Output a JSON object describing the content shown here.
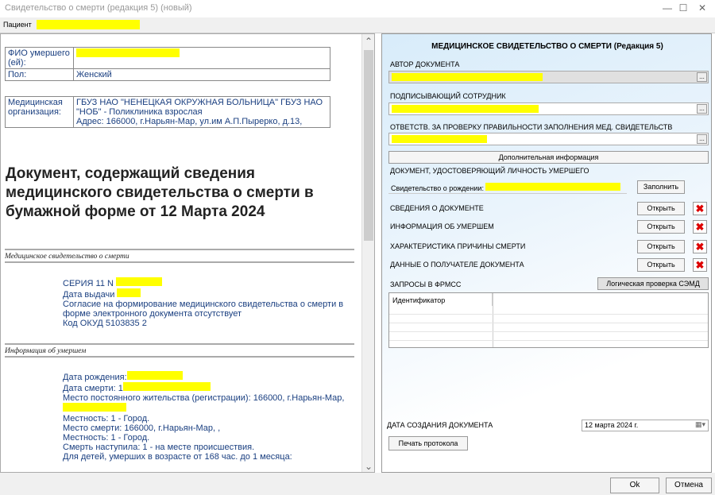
{
  "window": {
    "title": "Свидетельство о смерти (редакция 5) (новый)",
    "minimize": "—",
    "maximize": "☐",
    "close": "✕"
  },
  "patient": {
    "label": "Пациент"
  },
  "left": {
    "info_rows": [
      {
        "key": "ФИО умершего (ей):",
        "value": ""
      },
      {
        "key": "Пол:",
        "value": "Женский"
      }
    ],
    "org": {
      "key": "Медицинская организация:",
      "value": "ГБУЗ НАО \"НЕНЕЦКАЯ ОКРУЖНАЯ БОЛЬНИЦА\" ГБУЗ НАО \"НОБ\" - Поликлиника взрослая",
      "address": "Адрес: 166000, г.Нарьян-Мар, ул.им А.П.Пырерко, д.13,"
    },
    "doc_title": "Документ, содержащий сведения медицинского свидетельства о смерти в бумажной форме от 12 Марта 2024",
    "section1": {
      "title": "Медицинское свидетельство о смерти",
      "series": "СЕРИЯ 11 N",
      "issue_date": "Дата выдачи",
      "consent": "Согласие на формирование медицинского свидетельства о смерти в форме электронного документа отсутствует",
      "okud": "Код ОКУД 5103835 2"
    },
    "section2": {
      "title": "Информация об умершем",
      "birth": "Дата рождения:",
      "death": "Дата смерти: 1",
      "residence": "Место постоянного жительства (регистрации): 166000, г.Нарьян-Мар,",
      "locality1": "Местность: 1 - Город.",
      "death_place": "Место смерти: 166000, г.Нарьян-Мар, ,",
      "locality2": "Местность: 1 - Город.",
      "occurred": "Смерть наступила: 1 - на месте происшествия.",
      "children": "Для детей, умерших в возрасте от 168 час. до 1 месяца:"
    }
  },
  "right": {
    "title": "МЕДИЦИНСКОЕ СВИДЕТЕЛЬСТВО О СМЕРТИ (Редакция 5)",
    "author_label": "АВТОР ДОКУМЕНТА",
    "author_value": "",
    "signer_label": "ПОДПИСЫВАЮЩИЙ СОТРУДНИК",
    "signer_value": "",
    "checker_label": "ОТВЕТСТВ. ЗА ПРОВЕРКУ ПРАВИЛЬНОСТИ ЗАПОЛНЕНИЯ МЕД. СВИДЕТЕЛЬСТВ",
    "checker_value": "",
    "extra_btn": "Дополнительная информация",
    "id_doc_label": "ДОКУМЕНТ, УДОСТОВЕРЯЮЩИЙ ЛИЧНОСТЬ УМЕРШЕГО",
    "id_doc_value": "Свидетельство о рождении:",
    "fill_btn": "Заполнить",
    "sections": [
      {
        "label": "СВЕДЕНИЯ О ДОКУМЕНТЕ",
        "button": "Открыть"
      },
      {
        "label": "ИНФОРМАЦИЯ ОБ УМЕРШЕМ",
        "button": "Открыть"
      },
      {
        "label": "ХАРАКТЕРИСТИКА ПРИЧИНЫ СМЕРТИ",
        "button": "Открыть"
      },
      {
        "label": "ДАННЫЕ О ПОЛУЧАТЕЛЕ ДОКУМЕНТА",
        "button": "Открыть"
      }
    ],
    "frmss_label": "ЗАПРОСЫ В ФРМСС",
    "check_btn": "Логическая проверка СЭМД",
    "grid_header": "Идентификатор",
    "created_label": "ДАТА СОЗДАНИЯ ДОКУМЕНТА",
    "created_value": "12  марта  2024 г.",
    "print_btn": "Печать протокола"
  },
  "footer": {
    "ok": "Ok",
    "cancel": "Отмена"
  },
  "colors": {
    "highlight": "#ffff00",
    "accent_text": "#1a3f80",
    "delete": "#dd0000"
  }
}
